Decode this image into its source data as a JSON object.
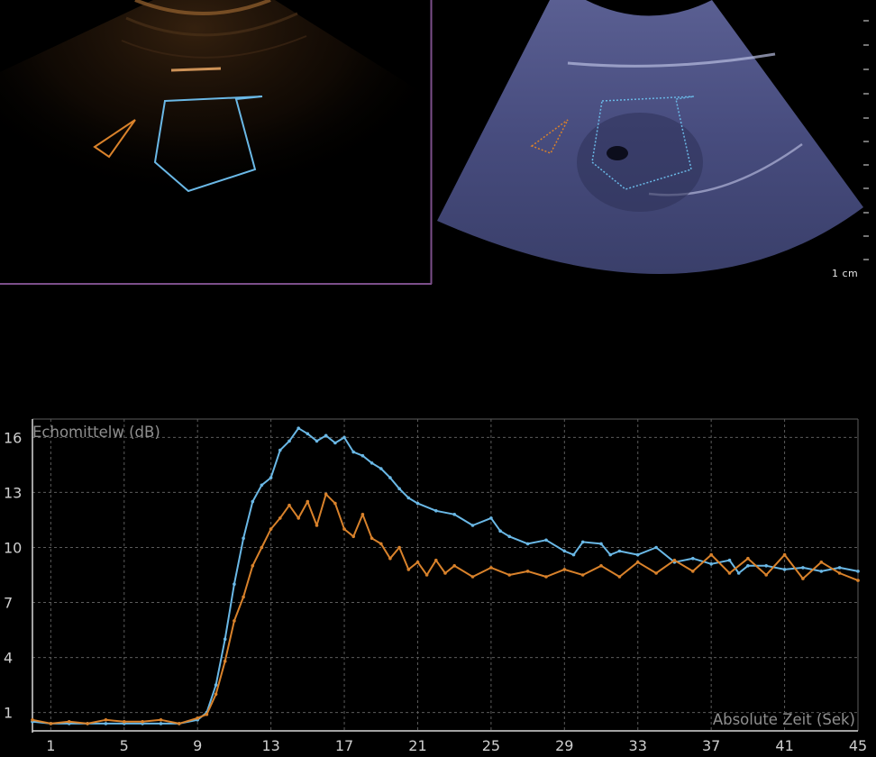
{
  "scale_label": "1 cm",
  "colors": {
    "roi_blue": "#6ab8e6",
    "roi_orange": "#d9822b",
    "left_frame": "#7c4f8a",
    "grid": "#5b5b5b",
    "axis": "#d8d8d8"
  },
  "chart_data": {
    "type": "line",
    "ylabel": "Echomittelw (dB)",
    "xlabel": "Absolute Zeit (Sek)",
    "xlim": [
      0,
      45
    ],
    "ylim": [
      0,
      17
    ],
    "x_ticks": [
      1,
      5,
      9,
      13,
      17,
      21,
      25,
      29,
      33,
      37,
      41,
      45
    ],
    "y_ticks": [
      1,
      4,
      7,
      10,
      13,
      16
    ],
    "grid": true,
    "series": [
      {
        "color": "#6ab8e6",
        "points": [
          [
            0,
            0.5
          ],
          [
            1,
            0.4
          ],
          [
            2,
            0.4
          ],
          [
            3,
            0.4
          ],
          [
            4,
            0.4
          ],
          [
            5,
            0.4
          ],
          [
            6,
            0.4
          ],
          [
            7,
            0.4
          ],
          [
            8,
            0.4
          ],
          [
            9,
            0.6
          ],
          [
            9.5,
            1.0
          ],
          [
            10,
            2.5
          ],
          [
            10.5,
            5
          ],
          [
            11,
            8
          ],
          [
            11.5,
            10.5
          ],
          [
            12,
            12.5
          ],
          [
            12.5,
            13.4
          ],
          [
            13,
            13.8
          ],
          [
            13.5,
            15.3
          ],
          [
            14,
            15.8
          ],
          [
            14.5,
            16.5
          ],
          [
            15,
            16.2
          ],
          [
            15.5,
            15.8
          ],
          [
            16,
            16.1
          ],
          [
            16.5,
            15.7
          ],
          [
            17,
            16.0
          ],
          [
            17.5,
            15.2
          ],
          [
            18,
            15.0
          ],
          [
            18.5,
            14.6
          ],
          [
            19,
            14.3
          ],
          [
            19.5,
            13.8
          ],
          [
            20,
            13.2
          ],
          [
            20.5,
            12.7
          ],
          [
            21,
            12.4
          ],
          [
            22,
            12.0
          ],
          [
            23,
            11.8
          ],
          [
            24,
            11.2
          ],
          [
            25,
            11.6
          ],
          [
            25.5,
            10.9
          ],
          [
            26,
            10.6
          ],
          [
            27,
            10.2
          ],
          [
            28,
            10.4
          ],
          [
            29,
            9.8
          ],
          [
            29.5,
            9.6
          ],
          [
            30,
            10.3
          ],
          [
            31,
            10.2
          ],
          [
            31.5,
            9.6
          ],
          [
            32,
            9.8
          ],
          [
            33,
            9.6
          ],
          [
            34,
            10.0
          ],
          [
            35,
            9.2
          ],
          [
            36,
            9.4
          ],
          [
            37,
            9.1
          ],
          [
            38,
            9.3
          ],
          [
            38.5,
            8.6
          ],
          [
            39,
            9.0
          ],
          [
            40,
            9.0
          ],
          [
            41,
            8.8
          ],
          [
            42,
            8.9
          ],
          [
            43,
            8.7
          ],
          [
            44,
            8.9
          ],
          [
            45,
            8.7
          ]
        ]
      },
      {
        "color": "#d9822b",
        "points": [
          [
            0,
            0.6
          ],
          [
            1,
            0.4
          ],
          [
            2,
            0.5
          ],
          [
            3,
            0.4
          ],
          [
            4,
            0.6
          ],
          [
            5,
            0.5
          ],
          [
            6,
            0.5
          ],
          [
            7,
            0.6
          ],
          [
            8,
            0.4
          ],
          [
            9,
            0.7
          ],
          [
            9.5,
            0.9
          ],
          [
            10,
            2.0
          ],
          [
            10.5,
            3.8
          ],
          [
            11,
            6.0
          ],
          [
            11.5,
            7.3
          ],
          [
            12,
            9.0
          ],
          [
            12.5,
            10.0
          ],
          [
            13,
            11.0
          ],
          [
            13.5,
            11.6
          ],
          [
            14,
            12.3
          ],
          [
            14.5,
            11.6
          ],
          [
            15,
            12.5
          ],
          [
            15.5,
            11.2
          ],
          [
            16,
            12.9
          ],
          [
            16.5,
            12.4
          ],
          [
            17,
            11.0
          ],
          [
            17.5,
            10.6
          ],
          [
            18,
            11.8
          ],
          [
            18.5,
            10.5
          ],
          [
            19,
            10.2
          ],
          [
            19.5,
            9.4
          ],
          [
            20,
            10.0
          ],
          [
            20.5,
            8.8
          ],
          [
            21,
            9.2
          ],
          [
            21.5,
            8.5
          ],
          [
            22,
            9.3
          ],
          [
            22.5,
            8.6
          ],
          [
            23,
            9.0
          ],
          [
            24,
            8.4
          ],
          [
            25,
            8.9
          ],
          [
            26,
            8.5
          ],
          [
            27,
            8.7
          ],
          [
            28,
            8.4
          ],
          [
            29,
            8.8
          ],
          [
            30,
            8.5
          ],
          [
            31,
            9.0
          ],
          [
            32,
            8.4
          ],
          [
            33,
            9.2
          ],
          [
            34,
            8.6
          ],
          [
            35,
            9.3
          ],
          [
            36,
            8.7
          ],
          [
            37,
            9.6
          ],
          [
            38,
            8.6
          ],
          [
            39,
            9.4
          ],
          [
            40,
            8.5
          ],
          [
            41,
            9.6
          ],
          [
            42,
            8.3
          ],
          [
            43,
            9.2
          ],
          [
            44,
            8.6
          ],
          [
            45,
            8.2
          ]
        ]
      }
    ]
  }
}
